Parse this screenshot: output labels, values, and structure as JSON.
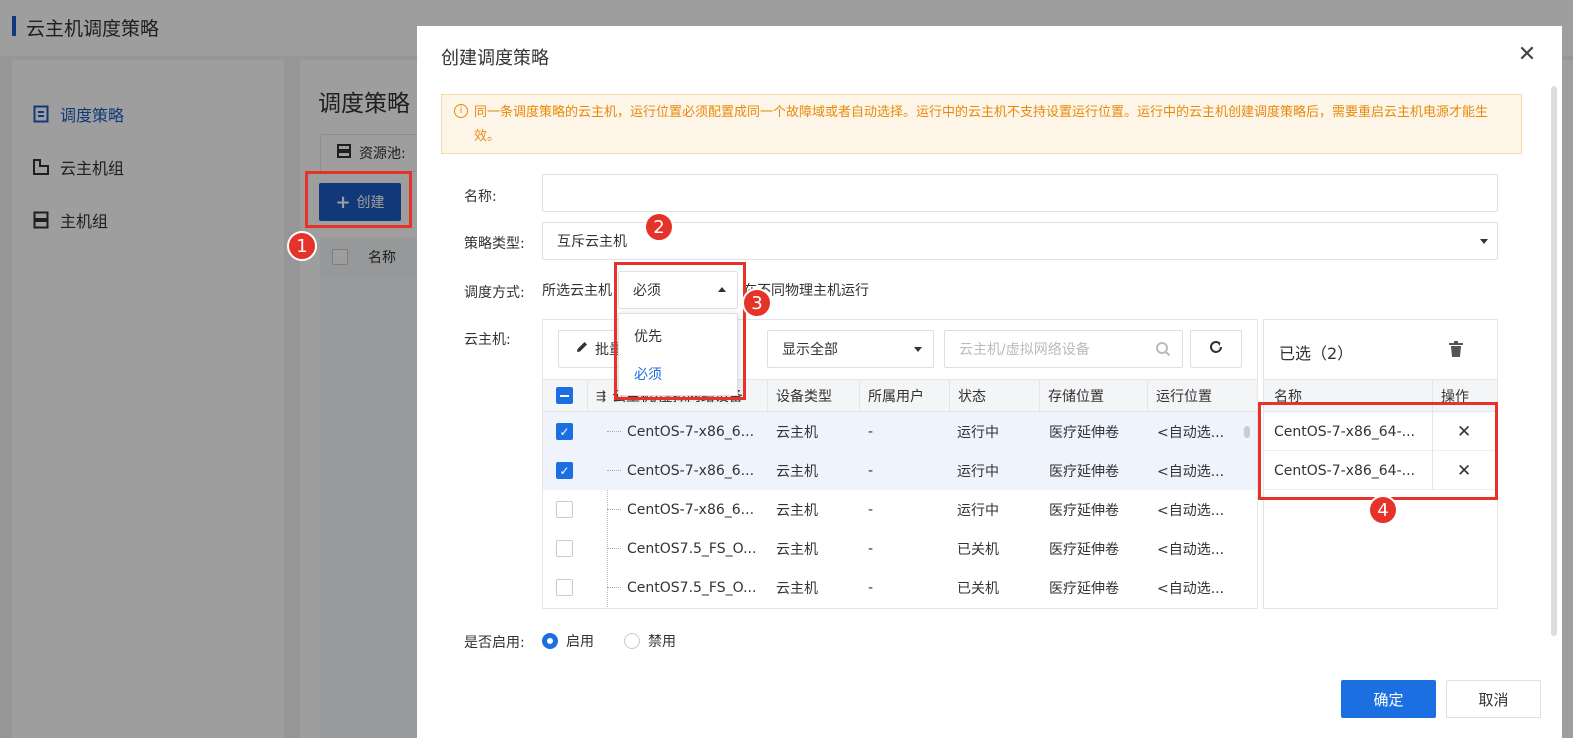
{
  "background": {
    "page_title": "云主机调度策略",
    "nav": [
      {
        "label": "调度策略",
        "icon": "policy-icon",
        "active": true
      },
      {
        "label": "云主机组",
        "icon": "vm-group-icon",
        "active": false
      },
      {
        "label": "主机组",
        "icon": "host-group-icon",
        "active": false
      }
    ],
    "main_title": "调度策略",
    "pool_label": "资源池:",
    "create_label": "创建",
    "table_header_name": "名称"
  },
  "modal": {
    "title": "创建调度策略",
    "notice": "同一条调度策略的云主机，运行位置必须配置成同一个故障域或者自动选择。运行中的云主机不支持设置运行位置。运行中的云主机创建调度策略后，需要重启云主机电源才能生效。",
    "name_label": "名称:",
    "name_value": "",
    "policy_type_label": "策略类型:",
    "policy_type_value": "互斥云主机",
    "schedule_label": "调度方式:",
    "schedule_prefix": "所选云主机",
    "schedule_value": "必须",
    "schedule_suffix": "在不同物理主机运行",
    "schedule_options": [
      "优先",
      "必须"
    ],
    "vm_label": "云主机:",
    "batch_label": "批量",
    "filter_value": "显示全部",
    "search_placeholder": "云主机/虚拟网络设备",
    "columns": [
      "云主机/虚拟网络设备",
      "设备类型",
      "所属用户",
      "状态",
      "存储位置",
      "运行位置"
    ],
    "rows": [
      {
        "checked": true,
        "name": "CentOS-7-x86_6...",
        "type": "云主机",
        "user": "-",
        "status": "运行中",
        "storage": "医疗延伸卷",
        "location": "<自动选..."
      },
      {
        "checked": true,
        "name": "CentOS-7-x86_6...",
        "type": "云主机",
        "user": "-",
        "status": "运行中",
        "storage": "医疗延伸卷",
        "location": "<自动选..."
      },
      {
        "checked": false,
        "name": "CentOS-7-x86_6...",
        "type": "云主机",
        "user": "-",
        "status": "运行中",
        "storage": "医疗延伸卷",
        "location": "<自动选..."
      },
      {
        "checked": false,
        "name": "CentOS7.5_FS_O...",
        "type": "云主机",
        "user": "-",
        "status": "已关机",
        "storage": "医疗延伸卷",
        "location": "<自动选..."
      },
      {
        "checked": false,
        "name": "CentOS7.5_FS_O...",
        "type": "云主机",
        "user": "-",
        "status": "已关机",
        "storage": "医疗延伸卷",
        "location": "<自动选..."
      }
    ],
    "selected_title": "已选（2）",
    "selected_columns": [
      "名称",
      "操作"
    ],
    "selected": [
      {
        "name": "CentOS-7-x86_64-..."
      },
      {
        "name": "CentOS-7-x86_64-..."
      }
    ],
    "enable_label": "是否启用:",
    "enable_on": "启用",
    "enable_off": "禁用",
    "confirm_label": "确定",
    "cancel_label": "取消"
  },
  "annotations": [
    "1",
    "2",
    "3",
    "4"
  ],
  "colors": {
    "primary": "#1c6fe0",
    "annotation": "#e5332a",
    "warning": "#e8890c"
  }
}
